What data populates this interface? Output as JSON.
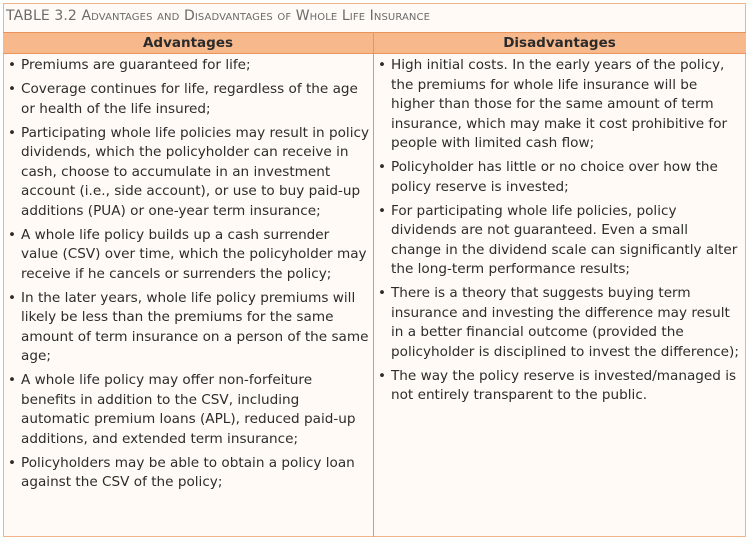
{
  "table": {
    "label": "TABLE 3.2",
    "caption": "Advantages and Disadvantages of Whole Life Insurance",
    "columns": [
      "Advantages",
      "Disadvantages"
    ],
    "advantages": [
      "Premiums are guaranteed for life;",
      "Coverage continues for life, regardless of the age or health of the life insured;",
      "Participating whole life policies may result in policy dividends, which the policyholder can receive in cash, choose to accumulate in an investment account (i.e., side account), or use to buy paid-up additions (PUA) or one-year term insurance;",
      "A whole life policy builds up a cash surrender value (CSV) over time, which the policyholder may receive if he cancels or surrenders the policy;",
      "In the later years, whole life policy premiums will likely be less than the premiums for the same amount of term insurance on a person of the same age;",
      "A whole life policy may offer non-forfeiture benefits in addition to the CSV, including automatic premium loans (APL), reduced paid-up additions, and extended term insurance;",
      "Policyholders may be able to obtain a policy loan against the CSV of the policy;"
    ],
    "disadvantages": [
      "High initial costs. In the early years of the policy, the premiums for whole life insurance will be higher than those for the same amount of term insurance, which may make it cost prohibitive for people with limited cash flow;",
      "Policyholder has little or no choice over how the policy reserve is invested;",
      "For participating whole life policies, policy dividends are not guaranteed. Even a small change in the dividend scale can significantly alter the long-term performance results;",
      "There is a theory that suggests buying term insurance and investing the difference may result in a better financial outcome (provided the policyholder is disciplined to invest the difference);",
      "The way the policy reserve is invested/managed is not entirely transparent to the public."
    ]
  }
}
